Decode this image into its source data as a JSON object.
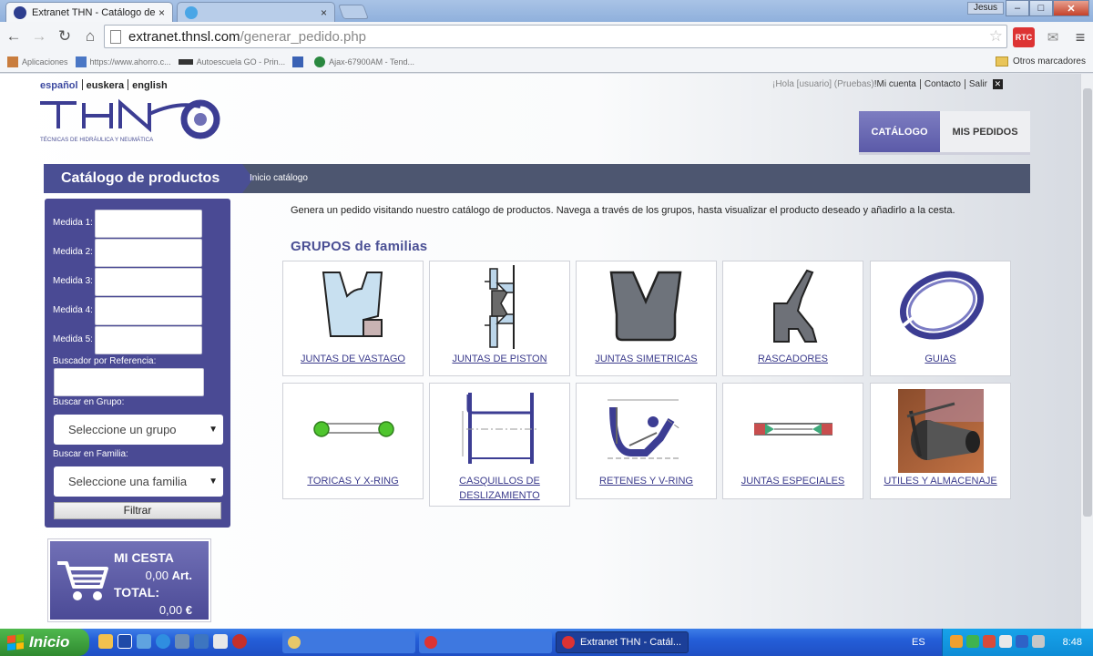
{
  "browser": {
    "tabs": [
      {
        "title": "Extranet THN - Catálogo de",
        "close": "×"
      },
      {
        "title": "",
        "close": "×"
      }
    ],
    "window_user": "Jesus",
    "window_buttons": {
      "minimize": "–",
      "maximize": "□",
      "close": "✕"
    },
    "url_domain": "extranet.thnsl.com",
    "url_path": "/generar_pedido.php",
    "bookmarks": [
      {
        "label": "Aplicaciones",
        "icon": "apps-icon"
      },
      {
        "label": "https://www.ahorro.c...",
        "icon": "page-icon"
      },
      {
        "label": "Autoescuela GO - Prin...",
        "icon": "car-icon"
      },
      {
        "label": "",
        "icon": "page-icon"
      },
      {
        "label": "Ajax-67900AM - Tend...",
        "icon": "flame-icon"
      }
    ],
    "bookmarks_other": "Otros marcadores",
    "ext_label": "RTC"
  },
  "site": {
    "languages": [
      "español",
      "euskera",
      "english"
    ],
    "logo_text": "THN",
    "logo_tagline": "TÉCNICAS DE HIDRÁULICA Y NEUMÁTICA",
    "greeting": "¡Hola [usuario] (Pruebas)",
    "greeting_mark": "!",
    "links": {
      "account": "Mi cuenta",
      "contact": "Contacto",
      "logout": "Salir",
      "logout_x": "✕"
    },
    "nav": {
      "catalog": "CATÁLOGO",
      "orders": "MIS PEDIDOS"
    },
    "page_title": "Catálogo de productos",
    "breadcrumb": "Inicio catálogo",
    "intro": "Genera un pedido visitando nuestro catálogo de productos. Navega a través de los grupos, hasta visualizar el producto deseado y añadirlo a la cesta.",
    "groups_title": "GRUPOS de familias"
  },
  "search": {
    "measures": [
      "Medida 1:",
      "Medida 2:",
      "Medida 3:",
      "Medida 4:",
      "Medida 5:"
    ],
    "reference_label": "Buscador por Referencia:",
    "group_label": "Buscar en Grupo:",
    "group_value": "Seleccione un grupo",
    "family_label": "Buscar en Familia:",
    "family_value": "Seleccione una familia",
    "filter_button": "Filtrar",
    "caret": "▼"
  },
  "cart": {
    "title": "MI CESTA",
    "articles": "0,00",
    "articles_unit": "Art.",
    "total_label": "TOTAL:",
    "total_value": "0,00",
    "currency": "€"
  },
  "groups": [
    {
      "label": "JUNTAS DE VASTAGO"
    },
    {
      "label": "JUNTAS DE PISTON"
    },
    {
      "label": "JUNTAS SIMETRICAS"
    },
    {
      "label": "RASCADORES"
    },
    {
      "label": "GUIAS"
    },
    {
      "label": "TORICAS Y X-RING"
    },
    {
      "label": "CASQUILLOS DE DESLIZAMIENTO"
    },
    {
      "label": "RETENES Y V-RING"
    },
    {
      "label": "JUNTAS ESPECIALES"
    },
    {
      "label": "UTILES Y ALMACENAJE"
    }
  ],
  "taskbar": {
    "start": "Inicio",
    "windows": [
      {
        "title": "",
        "active": false
      },
      {
        "title": "",
        "active": false
      },
      {
        "title": "Extranet THN - Catál...",
        "active": true
      }
    ],
    "language": "ES",
    "clock": "8:48"
  },
  "colors": {
    "brand_purple": "#4a4a94",
    "title_bar": "#4d5670",
    "link": "#3b3b8c",
    "seal_blue": "#c8e0f0"
  }
}
